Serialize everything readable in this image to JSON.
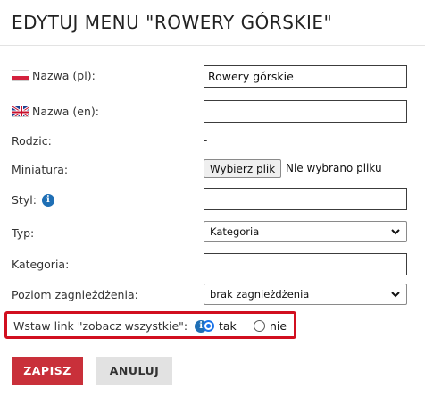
{
  "title": "EDYTUJ MENU \"ROWERY GÓRSKIE\"",
  "fields": {
    "name_pl": {
      "label": "Nazwa (pl):",
      "value": "Rowery górskie",
      "flag": "flag-pl-icon"
    },
    "name_en": {
      "label": "Nazwa (en):",
      "value": "",
      "flag": "flag-gb-icon"
    },
    "parent": {
      "label": "Rodzic:",
      "value": "-"
    },
    "thumbnail": {
      "label": "Miniatura:",
      "button_label": "Wybierz plik",
      "status": "Nie wybrano pliku"
    },
    "style": {
      "label": "Styl:",
      "value": "",
      "icon": "info-icon"
    },
    "type": {
      "label": "Typ:",
      "selected": "Kategoria"
    },
    "category": {
      "label": "Kategoria:",
      "value": ""
    },
    "nesting": {
      "label": "Poziom zagnieżdżenia:",
      "selected": "brak zagnieżdżenia"
    },
    "see_all_link": {
      "label": "Wstaw link \"zobacz wszystkie\":",
      "icon": "info-icon",
      "options": [
        {
          "label": "tak",
          "checked": true
        },
        {
          "label": "nie",
          "checked": false
        }
      ],
      "highlight_color": "#d10f1f"
    }
  },
  "buttons": {
    "save": "ZAPISZ",
    "cancel": "ANULUJ"
  },
  "colors": {
    "save_bg": "#c9303a",
    "cancel_bg": "#e2e2e2",
    "radio_accent": "#1a73e8",
    "info": "#1f6fb5"
  }
}
